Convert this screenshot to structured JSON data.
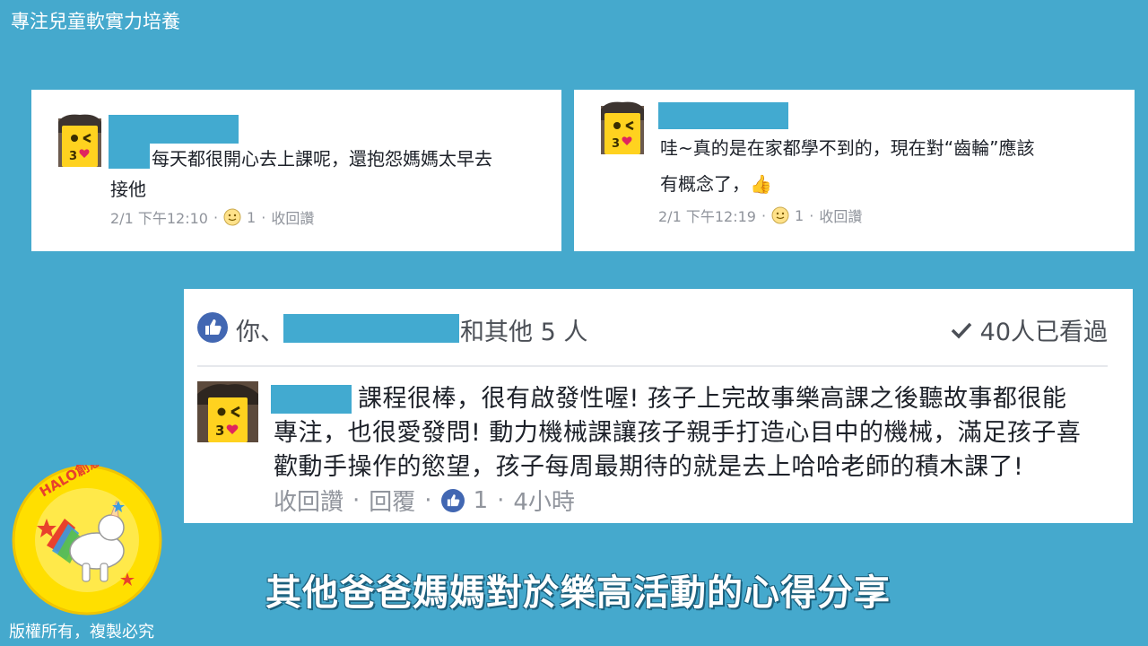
{
  "header": {
    "title": "專注兒童軟實力培養"
  },
  "footer": {
    "copyright": "版權所有，複製必究"
  },
  "caption": "其他爸爸媽媽對於樂高活動的心得分享",
  "logo": {
    "text": "HALO創意啟蒙樂園"
  },
  "comments": [
    {
      "text_line1": "每天都很開心去上課呢，還抱怨媽媽太早去",
      "text_line2": "接他",
      "date": "2/1 下午12:10",
      "dot": "·",
      "reaction_count": "1",
      "action": "收回讚"
    },
    {
      "text_line1": "哇~真的是在家都學不到的，現在對“齒輪”應該",
      "text_line2": "有概念了，👍",
      "date": "2/1 下午12:19",
      "dot": "·",
      "reaction_count": "1",
      "action": "收回讚"
    }
  ],
  "post": {
    "likes_prefix": "你、",
    "likes_suffix": "和其他 5 人",
    "seen": "40人已看過",
    "comment_line1": "課程很棒，很有啟發性喔! 孩子上完故事樂高課之後聽故事都很能",
    "comment_line2": "專注，也很愛發問! 動力機械課讓孩子親手打造心目中的機械，滿足孩子喜",
    "comment_line3": "歡動手操作的慾望，孩子每周最期待的就是去上哈哈老師的積木課了!",
    "action_unlike": "收回讚",
    "sep": "·",
    "action_reply": "回覆",
    "like_count": "1",
    "time": "4小時"
  },
  "colors": {
    "background": "#45a9cd",
    "redaction": "#42aad0",
    "fb_blue": "#4267b2"
  }
}
